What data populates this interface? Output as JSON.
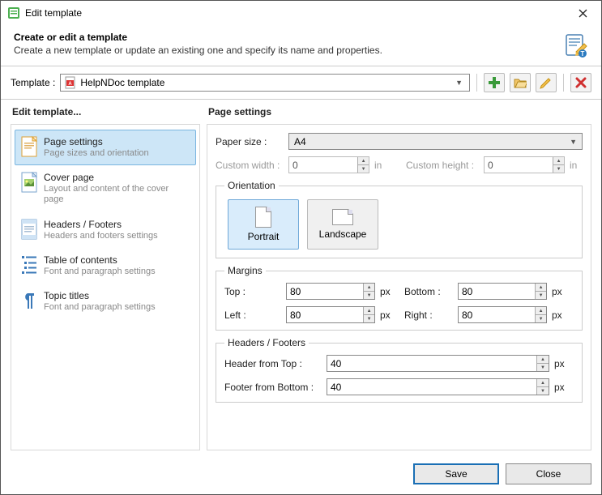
{
  "window": {
    "title": "Edit template"
  },
  "header": {
    "heading": "Create or edit a template",
    "description": "Create a new template or update an existing one and specify its name and properties."
  },
  "templateRow": {
    "label": "Template :",
    "selected": "HelpNDoc template"
  },
  "sidebar": {
    "title": "Edit template...",
    "items": [
      {
        "title": "Page settings",
        "subtitle": "Page sizes and orientation",
        "selected": true
      },
      {
        "title": "Cover page",
        "subtitle": "Layout and content of the cover page",
        "selected": false
      },
      {
        "title": "Headers / Footers",
        "subtitle": "Headers and footers settings",
        "selected": false
      },
      {
        "title": "Table of contents",
        "subtitle": "Font and paragraph settings",
        "selected": false
      },
      {
        "title": "Topic titles",
        "subtitle": "Font and paragraph settings",
        "selected": false
      }
    ]
  },
  "main": {
    "title": "Page settings",
    "paperSize": {
      "label": "Paper size :",
      "value": "A4"
    },
    "customWidth": {
      "label": "Custom width :",
      "value": "0",
      "unit": "in"
    },
    "customHeight": {
      "label": "Custom height :",
      "value": "0",
      "unit": "in"
    },
    "orientation": {
      "legend": "Orientation",
      "portrait": "Portrait",
      "landscape": "Landscape",
      "selected": "portrait"
    },
    "margins": {
      "legend": "Margins",
      "top": {
        "label": "Top :",
        "value": "80",
        "unit": "px"
      },
      "bottom": {
        "label": "Bottom :",
        "value": "80",
        "unit": "px"
      },
      "left": {
        "label": "Left :",
        "value": "80",
        "unit": "px"
      },
      "right": {
        "label": "Right :",
        "value": "80",
        "unit": "px"
      }
    },
    "headersFooters": {
      "legend": "Headers / Footers",
      "headerFromTop": {
        "label": "Header from Top :",
        "value": "40",
        "unit": "px"
      },
      "footerFromBottom": {
        "label": "Footer from Bottom :",
        "value": "40",
        "unit": "px"
      }
    }
  },
  "footer": {
    "save": "Save",
    "close": "Close"
  }
}
